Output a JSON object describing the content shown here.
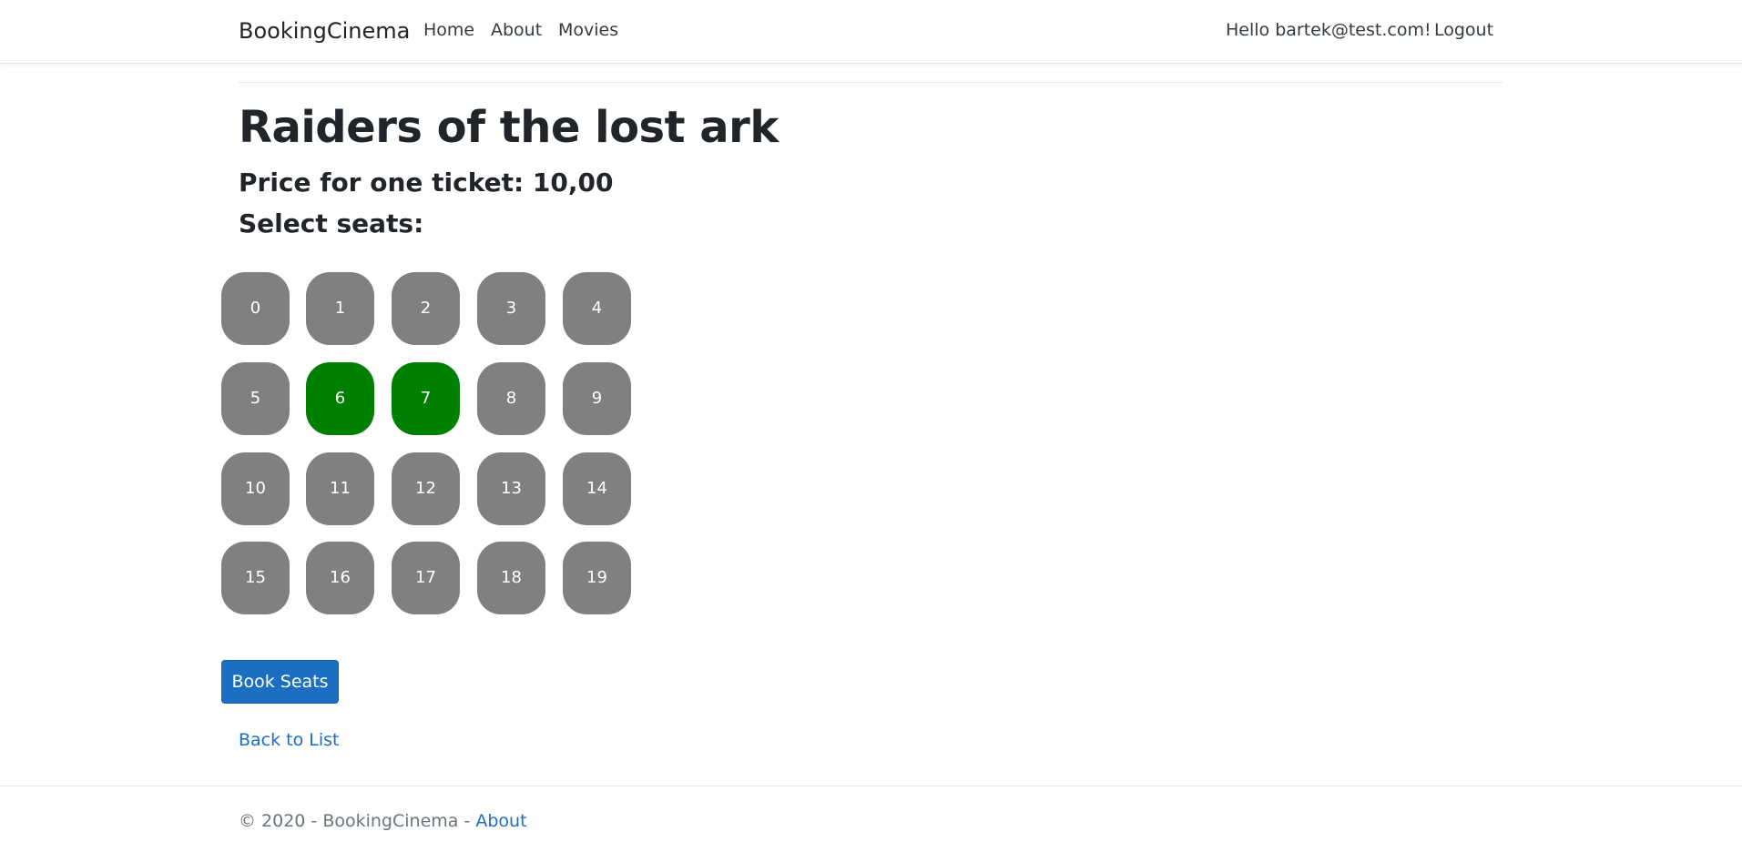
{
  "navbar": {
    "brand": "BookingCinema",
    "links": [
      "Home",
      "About",
      "Movies"
    ],
    "greeting": "Hello bartek@test.com!",
    "logout": "Logout"
  },
  "movie": {
    "title": "Raiders of the lost ark",
    "price_text": "Price for one ticket: 10,00",
    "select_label": "Select seats:"
  },
  "seats": [
    {
      "number": "0",
      "selected": false
    },
    {
      "number": "1",
      "selected": false
    },
    {
      "number": "2",
      "selected": false
    },
    {
      "number": "3",
      "selected": false
    },
    {
      "number": "4",
      "selected": false
    },
    {
      "number": "5",
      "selected": false
    },
    {
      "number": "6",
      "selected": true
    },
    {
      "number": "7",
      "selected": true
    },
    {
      "number": "8",
      "selected": false
    },
    {
      "number": "9",
      "selected": false
    },
    {
      "number": "10",
      "selected": false
    },
    {
      "number": "11",
      "selected": false
    },
    {
      "number": "12",
      "selected": false
    },
    {
      "number": "13",
      "selected": false
    },
    {
      "number": "14",
      "selected": false
    },
    {
      "number": "15",
      "selected": false
    },
    {
      "number": "16",
      "selected": false
    },
    {
      "number": "17",
      "selected": false
    },
    {
      "number": "18",
      "selected": false
    },
    {
      "number": "19",
      "selected": false
    }
  ],
  "colors": {
    "seat_available": "#808080",
    "seat_selected": "#008000",
    "primary": "#1b6ec2"
  },
  "actions": {
    "book_button": "Book Seats",
    "back_link": "Back to List"
  },
  "footer": {
    "text": "© 2020 - BookingCinema - ",
    "about_link": "About"
  }
}
